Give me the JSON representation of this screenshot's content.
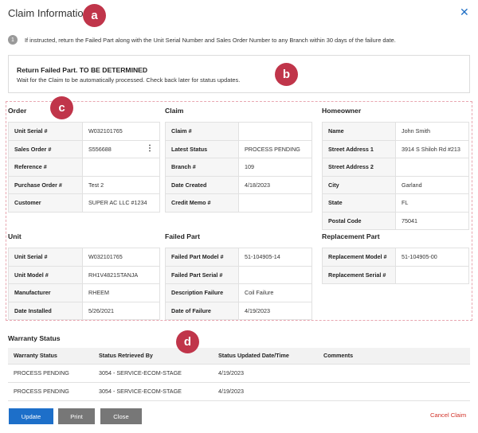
{
  "header": {
    "title": "Claim Information",
    "close_icon": "close-icon"
  },
  "badges": {
    "a": "a",
    "b": "b",
    "c": "c",
    "d": "d",
    "color": "#c0354a"
  },
  "instruction": {
    "number": "1",
    "text": "If instructed, return the Failed Part along with the Unit Serial Number and Sales Order Number to any Branch within 30 days of the failure date."
  },
  "notice": {
    "title": "Return Failed Part. TO BE DETERMINED",
    "text": "Wait for the Claim to be automatically processed. Check back later for status updates."
  },
  "order": {
    "title": "Order",
    "rows": [
      {
        "label": "Unit Serial #",
        "value": "W032101765"
      },
      {
        "label": "Sales Order #",
        "value": "S556688"
      },
      {
        "label": "Reference #",
        "value": ""
      },
      {
        "label": "Purchase Order #",
        "value": "Test 2"
      },
      {
        "label": "Customer",
        "value": "SUPER AC LLC #1234"
      }
    ]
  },
  "claim": {
    "title": "Claim",
    "rows": [
      {
        "label": "Claim #",
        "value": ""
      },
      {
        "label": "Latest Status",
        "value": "PROCESS PENDING"
      },
      {
        "label": "Branch #",
        "value": "109"
      },
      {
        "label": "Date Created",
        "value": "4/18/2023"
      },
      {
        "label": "Credit Memo #",
        "value": ""
      }
    ]
  },
  "homeowner": {
    "title": "Homeowner",
    "rows": [
      {
        "label": "Name",
        "value": "John Smith"
      },
      {
        "label": "Street Address 1",
        "value": "3914 S Shiloh Rd #213"
      },
      {
        "label": "Street Address 2",
        "value": ""
      },
      {
        "label": "City",
        "value": "Garland"
      },
      {
        "label": "State",
        "value": "FL"
      },
      {
        "label": "Postal Code",
        "value": "75041"
      }
    ]
  },
  "unit": {
    "title": "Unit",
    "rows": [
      {
        "label": "Unit Serial #",
        "value": "W032101765"
      },
      {
        "label": "Unit Model #",
        "value": "RH1V4821STANJA"
      },
      {
        "label": "Manufacturer",
        "value": "RHEEM"
      },
      {
        "label": "Date Installed",
        "value": "5/26/2021"
      }
    ]
  },
  "failed_part": {
    "title": "Failed Part",
    "rows": [
      {
        "label": "Failed Part Model #",
        "value": "51-104905-14"
      },
      {
        "label": "Failed Part Serial #",
        "value": ""
      },
      {
        "label": "Description Failure",
        "value": "Coil Failure"
      },
      {
        "label": "Date of Failure",
        "value": "4/19/2023"
      }
    ]
  },
  "replacement_part": {
    "title": "Replacement Part",
    "rows": [
      {
        "label": "Replacement Model #",
        "value": "51-104905-00"
      },
      {
        "label": "Replacement Serial #",
        "value": ""
      }
    ]
  },
  "warranty": {
    "title": "Warranty Status",
    "columns": [
      "Warranty Status",
      "Status Retrieved By",
      "Status Updated Date/Time",
      "Comments"
    ],
    "rows": [
      [
        "PROCESS PENDING",
        "3054 - SERVICE-ECOM-STAGE",
        "4/19/2023",
        ""
      ],
      [
        "PROCESS PENDING",
        "3054 - SERVICE-ECOM-STAGE",
        "4/19/2023",
        ""
      ]
    ]
  },
  "footer": {
    "update": "Update",
    "print": "Print",
    "close": "Close",
    "cancel_claim": "Cancel Claim"
  },
  "colors": {
    "accent": "#1d6fc9",
    "danger": "#d2342b",
    "button_gray": "#777777"
  }
}
